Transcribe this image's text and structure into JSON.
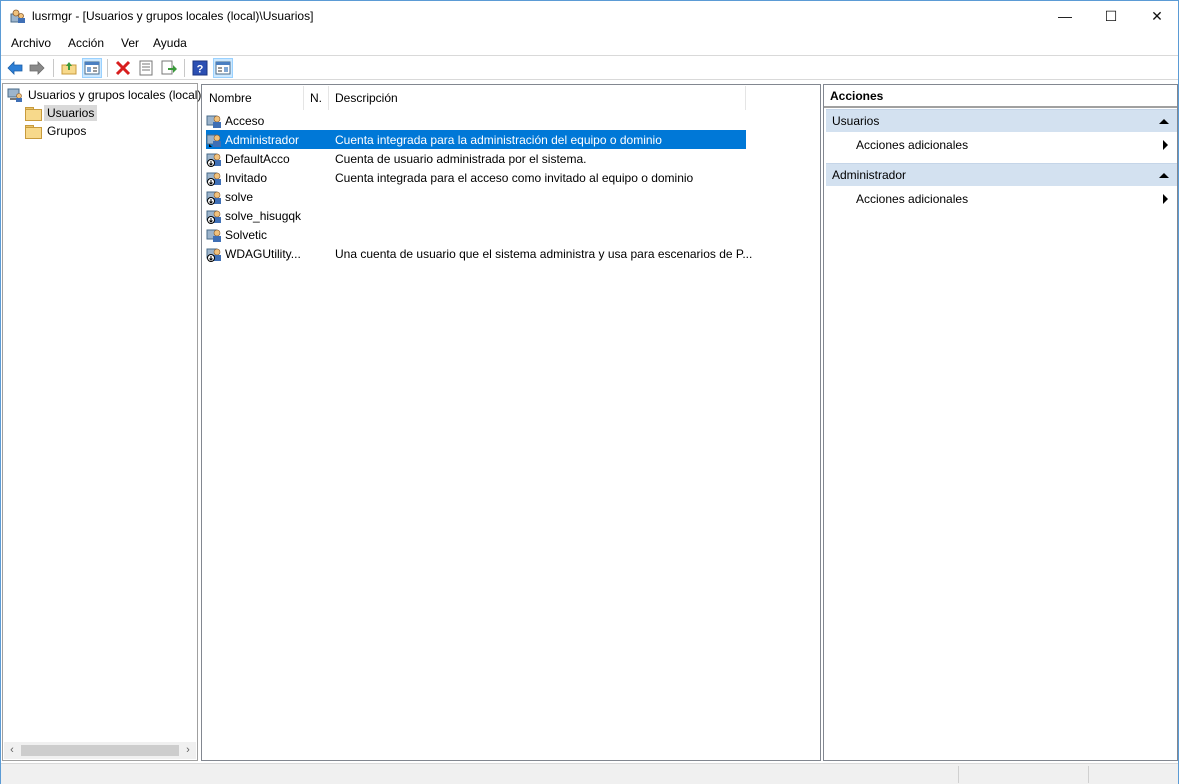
{
  "window": {
    "title": "lusrmgr - [Usuarios y grupos locales (local)\\Usuarios]",
    "controls": {
      "minimize": "—",
      "maximize": "☐",
      "close": "✕"
    }
  },
  "menu": [
    "Archivo",
    "Acción",
    "Ver",
    "Ayuda"
  ],
  "toolbar": {
    "icons": [
      "back-icon",
      "forward-icon",
      "up-folder-icon",
      "show-hide-tree-icon",
      "delete-icon",
      "properties-icon",
      "export-list-icon",
      "help-icon",
      "show-hide-action-pane-icon"
    ]
  },
  "tree": {
    "root": "Usuarios y grupos locales (local)",
    "children": [
      "Usuarios",
      "Grupos"
    ],
    "selected": "Usuarios",
    "scroll": {
      "left": "‹",
      "right": "›"
    }
  },
  "list": {
    "columns": [
      "Nombre",
      "N.",
      "Descripción"
    ],
    "rows": [
      {
        "name": "Acceso",
        "full": "",
        "desc": ""
      },
      {
        "name": "Administrador",
        "full": "",
        "desc": "Cuenta integrada para la administración del equipo o dominio"
      },
      {
        "name": "DefaultAcco",
        "full": "",
        "desc": "Cuenta de usuario administrada por el sistema."
      },
      {
        "name": "Invitado",
        "full": "",
        "desc": "Cuenta integrada para el acceso como invitado al equipo o dominio"
      },
      {
        "name": "solve",
        "full": "",
        "desc": ""
      },
      {
        "name": "solve_hisugqk",
        "full": "",
        "desc": ""
      },
      {
        "name": "Solvetic",
        "full": "",
        "desc": ""
      },
      {
        "name": "WDAGUtility...",
        "full": "",
        "desc": "Una cuenta de usuario que el sistema administra y usa para escenarios de P..."
      }
    ],
    "selected_index": 1
  },
  "actions": {
    "title": "Acciones",
    "groups": [
      {
        "label": "Usuarios",
        "items": [
          "Acciones adicionales"
        ]
      },
      {
        "label": "Administrador",
        "items": [
          "Acciones adicionales"
        ]
      }
    ]
  },
  "colors": {
    "selection": "#0078d7",
    "action_group_bg": "#d3e1f0",
    "tree_selection": "#d9d9d9"
  }
}
